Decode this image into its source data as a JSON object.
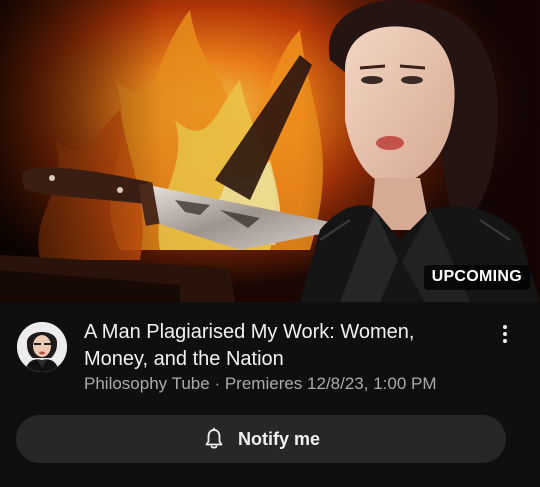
{
  "video": {
    "thumbnail_alt": "Woman in black leather jacket beside a knife in front of flames",
    "badge": "UPCOMING",
    "title": "A Man Plagiarised My Work: Women, Money, and the Nation",
    "channel": "Philosophy Tube",
    "separator": "·",
    "premiere": "Premieres 12/8/23, 1:00 PM"
  },
  "actions": {
    "notify_label": "Notify me",
    "more_icon": "more-vertical-icon",
    "bell_icon": "bell-icon"
  },
  "colors": {
    "background": "#0f0f0f",
    "button_bg": "#272727",
    "text_primary": "#f1f1f1",
    "text_secondary": "#aaaaaa"
  }
}
